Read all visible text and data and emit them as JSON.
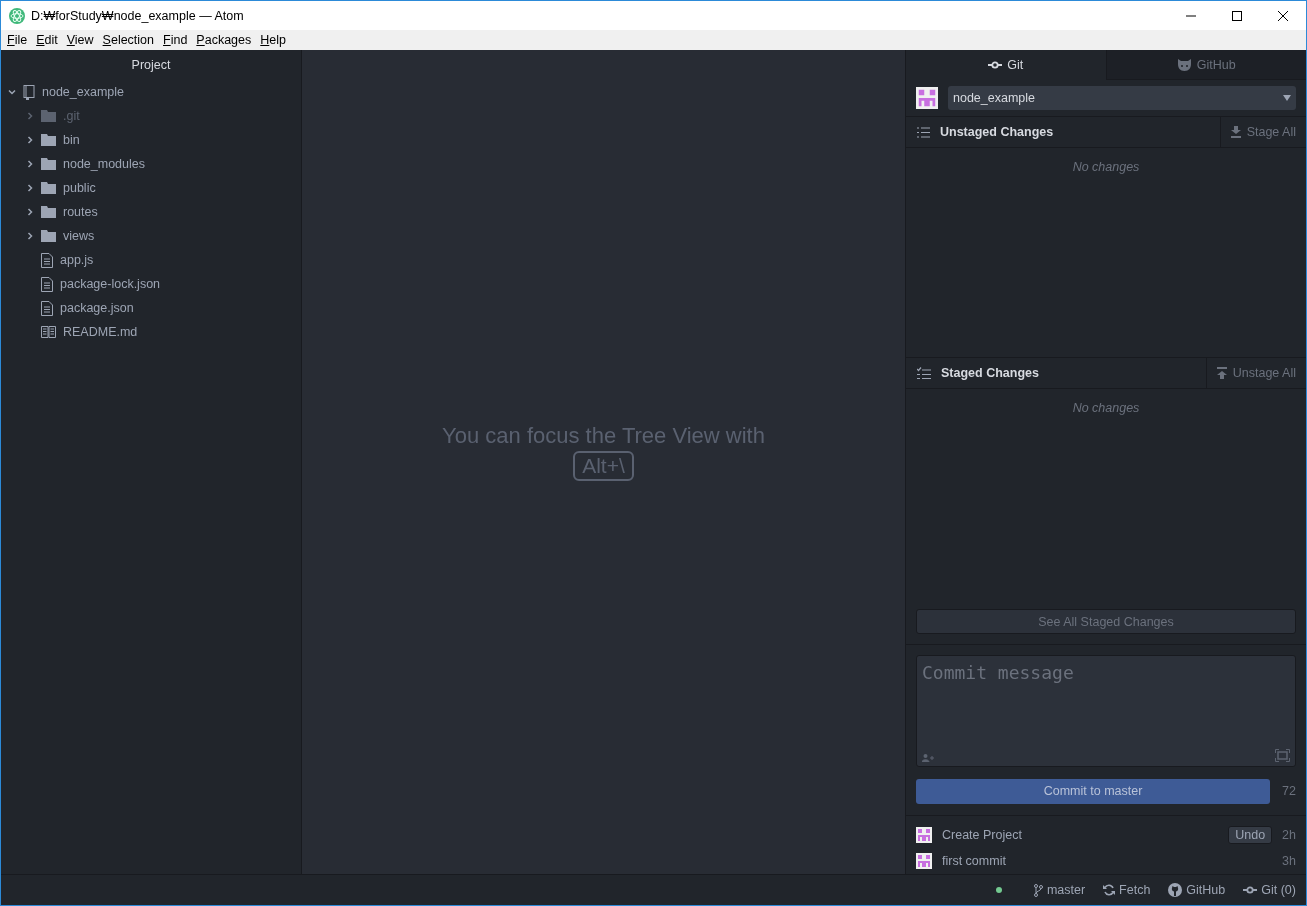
{
  "window": {
    "title": "D:₩forStudy₩node_example — Atom"
  },
  "menu": [
    "File",
    "Edit",
    "View",
    "Selection",
    "Find",
    "Packages",
    "Help"
  ],
  "tree_view": {
    "title": "Project",
    "root": {
      "name": "node_example",
      "expanded": true,
      "children": [
        {
          "name": ".git",
          "kind": "folder",
          "expanded": false,
          "ignored": true
        },
        {
          "name": "bin",
          "kind": "folder",
          "expanded": false,
          "ignored": false
        },
        {
          "name": "node_modules",
          "kind": "folder",
          "expanded": false,
          "ignored": false
        },
        {
          "name": "public",
          "kind": "folder",
          "expanded": false,
          "ignored": false
        },
        {
          "name": "routes",
          "kind": "folder",
          "expanded": false,
          "ignored": false
        },
        {
          "name": "views",
          "kind": "folder",
          "expanded": false,
          "ignored": false
        },
        {
          "name": "app.js",
          "kind": "file",
          "ignored": false
        },
        {
          "name": "package-lock.json",
          "kind": "file",
          "ignored": false
        },
        {
          "name": "package.json",
          "kind": "file",
          "ignored": false
        },
        {
          "name": "README.md",
          "kind": "readme",
          "ignored": false
        }
      ]
    }
  },
  "editor": {
    "hint": "You can focus the Tree View with",
    "shortcut": "Alt+\\"
  },
  "git_panel": {
    "tabs": [
      {
        "label": "Git",
        "kind": "git",
        "selected": true
      },
      {
        "label": "GitHub",
        "kind": "github",
        "selected": false
      }
    ],
    "repository": "node_example",
    "unstaged": {
      "title": "Unstaged Changes",
      "action": "Stage All",
      "empty": "No changes"
    },
    "staged": {
      "title": "Staged Changes",
      "action": "Unstage All",
      "empty": "No changes"
    },
    "see_all": "See All Staged Changes",
    "commit": {
      "placeholder": "Commit message",
      "button": "Commit to master",
      "remaining": "72"
    },
    "recent_commits": [
      {
        "message": "Create Project",
        "undo": "Undo",
        "age": "2h"
      },
      {
        "message": "first commit",
        "age": "3h"
      }
    ]
  },
  "status_bar": {
    "branch": "master",
    "fetch": "Fetch",
    "github": "GitHub",
    "git": "Git (0)"
  }
}
